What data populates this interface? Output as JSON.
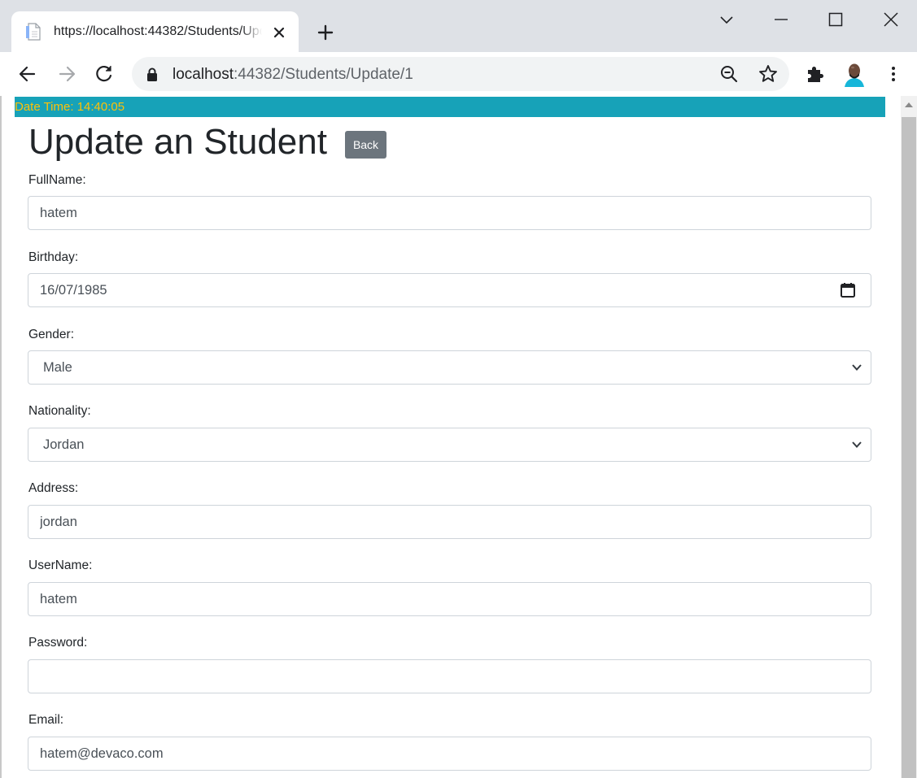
{
  "browser": {
    "tab_title": "https://localhost:44382/Students/Update/1",
    "url_host": "localhost",
    "url_rest": ":44382/Students/Update/1",
    "icons": {
      "favicon": "page-icon",
      "tab_close": "close-icon",
      "new_tab": "plus-icon",
      "tab_search": "chevron-down-icon",
      "minimize": "minimize-icon",
      "maximize": "maximize-icon",
      "close_window": "close-icon",
      "back": "arrow-left-icon",
      "forward": "arrow-right-icon",
      "reload": "reload-icon",
      "lock": "lock-icon",
      "zoom": "zoom-out-icon",
      "bookmark": "star-icon",
      "extensions": "puzzle-icon",
      "profile": "avatar",
      "menu": "kebab-menu-icon"
    }
  },
  "page": {
    "datetime": "Date Time: 14:40:05",
    "title": "Update an Student",
    "back_label": "Back",
    "colors": {
      "datebar_bg": "#17a2b8",
      "datebar_text": "#ffc107",
      "back_button": "#6c757d"
    }
  },
  "form": {
    "fullname": {
      "label": "FullName:",
      "value": "hatem"
    },
    "birthday": {
      "label": "Birthday:",
      "value": "16/07/1985"
    },
    "gender": {
      "label": "Gender:",
      "value": "Male"
    },
    "nationality": {
      "label": "Nationality:",
      "value": "Jordan"
    },
    "address": {
      "label": "Address:",
      "value": "jordan"
    },
    "username": {
      "label": "UserName:",
      "value": "hatem"
    },
    "password": {
      "label": "Password:",
      "value": ""
    },
    "email": {
      "label": "Email:",
      "value": "hatem@devaco.com"
    }
  }
}
